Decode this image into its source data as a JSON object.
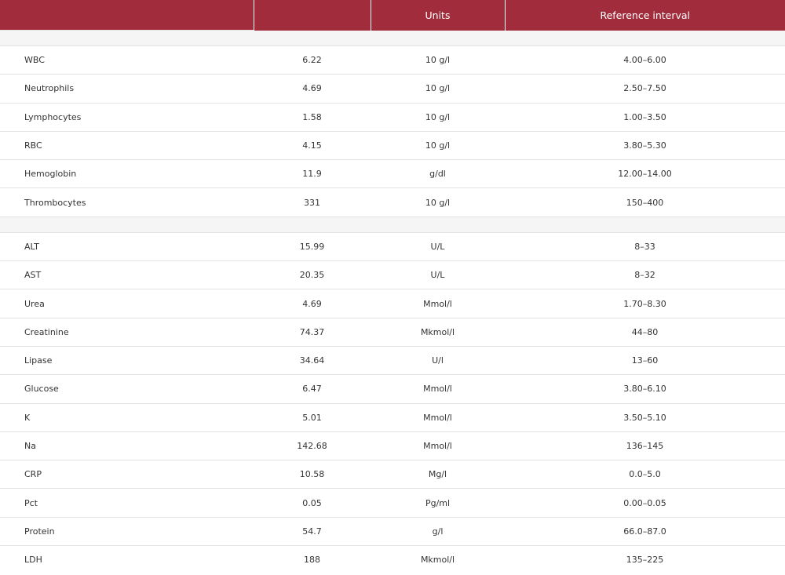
{
  "header": {
    "col1": "",
    "col2": "",
    "col3": "Units",
    "col4": "Reference interval"
  },
  "sections": [
    {
      "rows": [
        {
          "name": "WBC",
          "value": "6.22",
          "units": "10 g/l",
          "ref": "4.00–6.00"
        },
        {
          "name": "Neutrophils",
          "value": "4.69",
          "units": "10 g/l",
          "ref": "2.50–7.50"
        },
        {
          "name": "Lymphocytes",
          "value": "1.58",
          "units": "10 g/l",
          "ref": "1.00–3.50"
        },
        {
          "name": "RBC",
          "value": "4.15",
          "units": "10 g/l",
          "ref": "3.80–5.30"
        },
        {
          "name": "Hemoglobin",
          "value": "11.9",
          "units": "g/dl",
          "ref": "12.00–14.00"
        },
        {
          "name": "Thrombocytes",
          "value": "331",
          "units": "10 g/l",
          "ref": "150–400"
        }
      ]
    },
    {
      "rows": [
        {
          "name": "ALT",
          "value": "15.99",
          "units": "U/L",
          "ref": "8–33"
        },
        {
          "name": "AST",
          "value": "20.35",
          "units": "U/L",
          "ref": "8–32"
        },
        {
          "name": "Urea",
          "value": "4.69",
          "units": "Mmol/l",
          "ref": "1.70–8.30"
        },
        {
          "name": "Creatinine",
          "value": "74.37",
          "units": "Mkmol/l",
          "ref": "44–80"
        },
        {
          "name": "Lipase",
          "value": "34.64",
          "units": "U/l",
          "ref": "13–60"
        },
        {
          "name": "Glucose",
          "value": "6.47",
          "units": "Mmol/l",
          "ref": "3.80–6.10"
        },
        {
          "name": "K",
          "value": "5.01",
          "units": "Mmol/l",
          "ref": "3.50–5.10"
        },
        {
          "name": "Na",
          "value": "142.68",
          "units": "Mmol/l",
          "ref": "136–145"
        },
        {
          "name": "CRP",
          "value": "10.58",
          "units": "Mg/l",
          "ref": "0.0–5.0"
        },
        {
          "name": "Pct",
          "value": "0.05",
          "units": "Pg/ml",
          "ref": "0.00–0.05"
        },
        {
          "name": "Protein",
          "value": "54.7",
          "units": "g/l",
          "ref": "66.0–87.0"
        },
        {
          "name": "LDH",
          "value": "188",
          "units": "Mkmol/l",
          "ref": "135–225"
        }
      ]
    }
  ]
}
